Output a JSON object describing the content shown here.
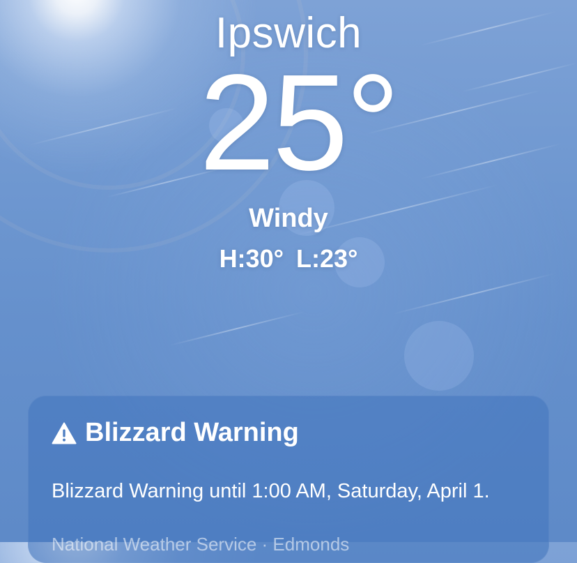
{
  "location": {
    "city": "Ipswich",
    "temperature": "25°",
    "condition": "Windy",
    "high": "H:30°",
    "low": "L:23°"
  },
  "alert": {
    "icon": "warning-triangle-icon",
    "title": "Blizzard Warning",
    "description": "Blizzard Warning until 1:00 AM, Saturday, April 1.",
    "source": "National Weather Service · Edmonds"
  },
  "colors": {
    "sky_top": "#7ea2d6",
    "sky_bottom": "#5e8ac8",
    "card_background": "#4678be",
    "text": "#ffffff"
  }
}
